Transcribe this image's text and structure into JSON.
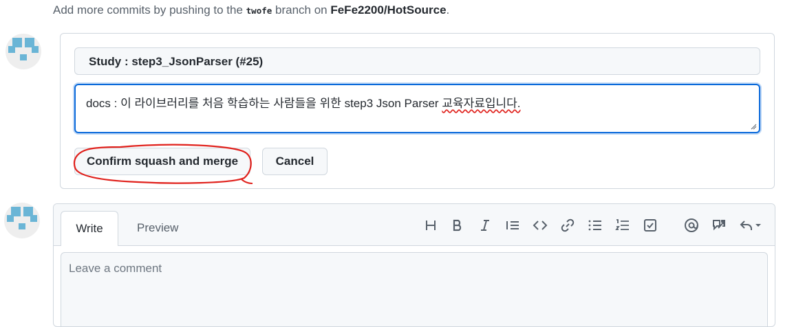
{
  "top_note": {
    "prefix": "Add more commits by pushing to the ",
    "branch": "twofe",
    "middle": " branch on ",
    "repo": "FeFe2200/HotSource",
    "suffix": "."
  },
  "merge": {
    "title_value": "Study : step3_JsonParser  (#25)",
    "description_value_main": "docs : 이 라이브러리를 처음 학습하는 사람들을 위한 step3 Json Parser  ",
    "description_value_flagged": "교육자료입니다.",
    "confirm_label": "Confirm squash and merge",
    "cancel_label": "Cancel",
    "annotation_color": "#e0201b"
  },
  "comment": {
    "tabs": [
      {
        "label": "Write"
      },
      {
        "label": "Preview"
      }
    ],
    "toolbar_icons": [
      "heading-icon",
      "bold-icon",
      "italic-icon",
      "quote-icon",
      "code-icon",
      "link-icon",
      "unordered-list-icon",
      "ordered-list-icon",
      "task-list-icon",
      "mention-icon",
      "reference-icon",
      "reply-icon"
    ],
    "placeholder": "Leave a comment"
  },
  "colors": {
    "accent": "#0969da",
    "border": "#d0d7de",
    "avatar": "#6ab5d6"
  }
}
